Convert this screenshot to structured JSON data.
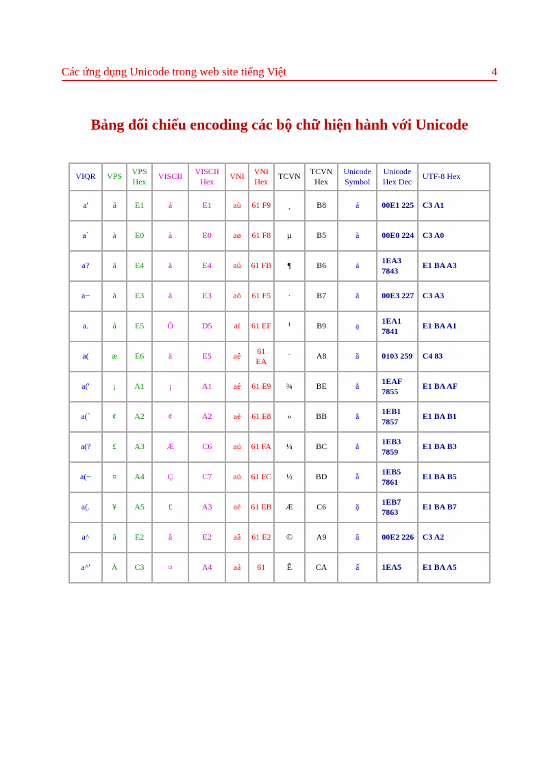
{
  "header": {
    "title": "Các ứng dụng Unicode trong web site tiếng Việt",
    "page": "4"
  },
  "title": "Bảng đối chiếu encoding các bộ chữ hiện hành với Unicode",
  "columns": [
    {
      "label": "VIQR",
      "cls": "c-blue col-viqr"
    },
    {
      "label": "VPS",
      "cls": "c-green col-vps"
    },
    {
      "label": "VPS Hex",
      "cls": "c-green col-vpshex"
    },
    {
      "label": "VISCII",
      "cls": "c-magenta col-viscii"
    },
    {
      "label": "VISCII Hex",
      "cls": "c-magenta col-visciihex"
    },
    {
      "label": "VNI",
      "cls": "c-red col-vni"
    },
    {
      "label": "VNI Hex",
      "cls": "c-red col-vnihex"
    },
    {
      "label": "TCVN",
      "cls": "c-black col-tcvn"
    },
    {
      "label": "TCVN Hex",
      "cls": "c-black col-tcvnhex"
    },
    {
      "label": "Unicode Symbol",
      "cls": "c-blue col-usym"
    },
    {
      "label": "Unicode Hex Dec",
      "cls": "c-navy col-uhex"
    },
    {
      "label": "UTF-8 Hex",
      "cls": "c-navy col-utf8"
    }
  ],
  "rows": [
    {
      "viqr": "a'",
      "vps": "á",
      "vpshex": "E1",
      "viscii": "á",
      "visciihex": "E1",
      "vni": "aù",
      "vnihex": "61 F9",
      "tcvn": "¸",
      "tcvnhex": "B8",
      "usym": "á",
      "uhex": "00E1 225",
      "utf8": "C3 A1"
    },
    {
      "viqr": "a`",
      "vps": "à",
      "vpshex": "E0",
      "viscii": "à",
      "visciihex": "E0",
      "vni": "aø",
      "vnihex": "61 F8",
      "tcvn": "µ",
      "tcvnhex": "B5",
      "usym": "à",
      "uhex": "00E0 224",
      "utf8": "C3 A0"
    },
    {
      "viqr": "a?",
      "vps": "ä",
      "vpshex": "E4",
      "viscii": "ä",
      "visciihex": "E4",
      "vni": "aû",
      "vnihex": "61 FB",
      "tcvn": "¶",
      "tcvnhex": "B6",
      "usym": "ả",
      "uhex": "1EA3 7843",
      "utf8": "E1 BA A3"
    },
    {
      "viqr": "a~",
      "vps": "ã",
      "vpshex": "E3",
      "viscii": "ã",
      "visciihex": "E3",
      "vni": "aõ",
      "vnihex": "61 F5",
      "tcvn": "·",
      "tcvnhex": "B7",
      "usym": "ã",
      "uhex": "00E3 227",
      "utf8": "C3 A3"
    },
    {
      "viqr": "a.",
      "vps": "å",
      "vpshex": "E5",
      "viscii": "Õ",
      "visciihex": "D5",
      "vni": "aï",
      "vnihex": "61 EF",
      "tcvn": "¹",
      "tcvnhex": "B9",
      "usym": "ạ",
      "uhex": "1EA1 7841",
      "utf8": "E1 BA A1"
    },
    {
      "viqr": "a(",
      "vps": "æ",
      "vpshex": "E6",
      "viscii": "ä",
      "visciihex": "E5",
      "vni": "aê",
      "vnihex": "61 EA",
      "tcvn": "¨",
      "tcvnhex": "A8",
      "usym": "ă",
      "uhex": "0103 259",
      "utf8": "C4 83"
    },
    {
      "viqr": "a('",
      "vps": "¡",
      "vpshex": "A1",
      "viscii": "¡",
      "visciihex": "A1",
      "vni": "aé",
      "vnihex": "61 E9",
      "tcvn": "¾",
      "tcvnhex": "BE",
      "usym": "ắ",
      "uhex": "1EAF 7855",
      "utf8": "E1 BA AF"
    },
    {
      "viqr": "a(`",
      "vps": "¢",
      "vpshex": "A2",
      "viscii": "¢",
      "visciihex": "A2",
      "vni": "aè",
      "vnihex": "61 E8",
      "tcvn": "»",
      "tcvnhex": "BB",
      "usym": "ằ",
      "uhex": "1EB1 7857",
      "utf8": "E1 BA B1"
    },
    {
      "viqr": "a(?",
      "vps": "£",
      "vpshex": "A3",
      "viscii": "Æ",
      "visciihex": "C6",
      "vni": "aú",
      "vnihex": "61 FA",
      "tcvn": "¼",
      "tcvnhex": "BC",
      "usym": "ẳ",
      "uhex": "1EB3 7859",
      "utf8": "E1 BA B3"
    },
    {
      "viqr": "a(~",
      "vps": "¤",
      "vpshex": "A4",
      "viscii": "Ç",
      "visciihex": "C7",
      "vni": "aü",
      "vnihex": "61 FC",
      "tcvn": "½",
      "tcvnhex": "BD",
      "usym": "ẵ",
      "uhex": "1EB5 7861",
      "utf8": "E1 BA B5"
    },
    {
      "viqr": "a(.",
      "vps": "¥",
      "vpshex": "A5",
      "viscii": "£",
      "visciihex": "A3",
      "vni": "aë",
      "vnihex": "61 EB",
      "tcvn": "Æ",
      "tcvnhex": "C6",
      "usym": "ặ",
      "uhex": "1EB7 7863",
      "utf8": "E1 BA B7"
    },
    {
      "viqr": "a^",
      "vps": "â",
      "vpshex": "E2",
      "viscii": "â",
      "visciihex": "E2",
      "vni": "aâ",
      "vnihex": "61 E2",
      "tcvn": "©",
      "tcvnhex": "A9",
      "usym": "â",
      "uhex": "00E2 226",
      "utf8": "C3 A2"
    },
    {
      "viqr": "a^'",
      "vps": "Ã",
      "vpshex": "C3",
      "viscii": "¤",
      "visciihex": "A4",
      "vni": "aá",
      "vnihex": "61",
      "tcvn": "Ê",
      "tcvnhex": "CA",
      "usym": "ấ",
      "uhex": "1EA5",
      "utf8": "E1 BA A5"
    }
  ]
}
